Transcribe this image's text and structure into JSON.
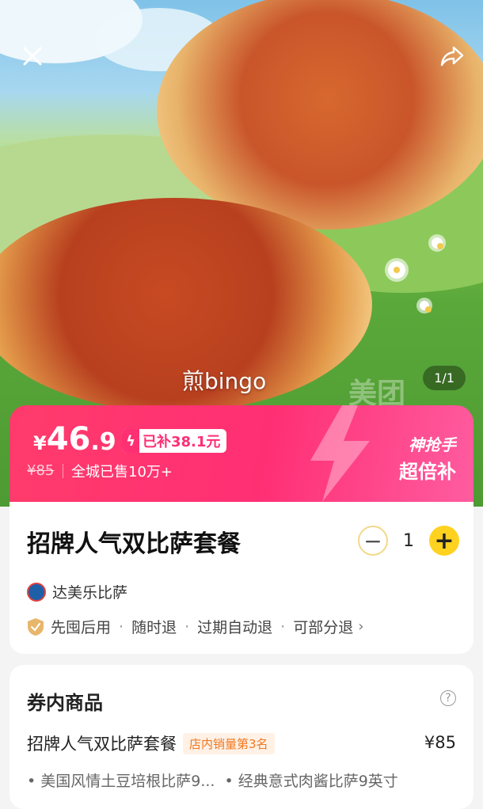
{
  "hero": {
    "watermark": "煎bingo",
    "watermark_bg": "美团",
    "image_counter": "1/1"
  },
  "price_band": {
    "currency": "¥",
    "price_int": "46",
    "price_dec": ".9",
    "subsidy": "已补38.1元",
    "original_price": "¥85",
    "sold": "全城已售10万+",
    "promo_line1": "神抢手",
    "promo_line2": "超倍补"
  },
  "product": {
    "title": "招牌人气双比萨套餐",
    "quantity": "1",
    "brand": "达美乐比萨",
    "guarantees": [
      "先囤后用",
      "随时退",
      "过期自动退",
      "可部分退"
    ]
  },
  "coupon": {
    "section_title": "券内商品",
    "item_name": "招牌人气双比萨套餐",
    "rank_badge": "店内销量第3名",
    "item_price": "¥85",
    "sub_items": [
      "美国风情土豆培根比萨9...",
      "经典意式肉酱比萨9英寸"
    ]
  },
  "colors": {
    "accent": "#ff2f74",
    "plus_button": "#ffd21f"
  }
}
